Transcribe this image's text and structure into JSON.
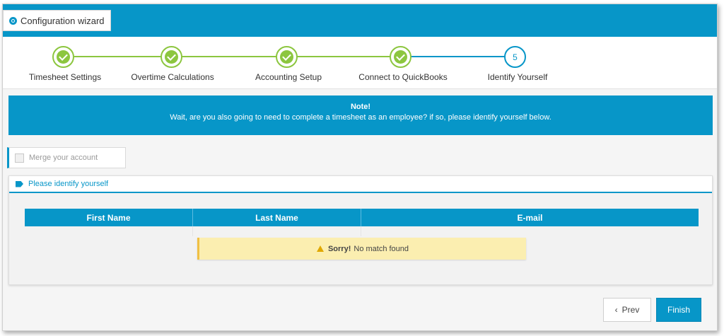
{
  "header": {
    "wizard_label": "Configuration wizard",
    "wizard_icon": "circle-arrow-icon",
    "accent_color": "#0796c8"
  },
  "steps": [
    {
      "label": "Timesheet Settings",
      "state": "complete"
    },
    {
      "label": "Overtime Calculations",
      "state": "complete"
    },
    {
      "label": "Accounting Setup",
      "state": "complete"
    },
    {
      "label": "Connect to QuickBooks",
      "state": "complete"
    },
    {
      "label": "Identify Yourself",
      "state": "active",
      "number": "5"
    }
  ],
  "note": {
    "title": "Note!",
    "message": "Wait, are you also going to need to complete a timesheet as an employee? if so, please identify yourself below."
  },
  "merge": {
    "label": "Merge your account",
    "checked": false
  },
  "panel": {
    "title": "Please identify yourself",
    "icon": "tag-icon"
  },
  "table": {
    "columns": [
      "First Name",
      "Last Name",
      "E-mail"
    ]
  },
  "alert": {
    "strong": "Sorry!",
    "message": "No match found",
    "color": "#fbeeb0"
  },
  "buttons": {
    "prev_label": "Prev",
    "prev_icon": "‹",
    "finish_label": "Finish"
  }
}
